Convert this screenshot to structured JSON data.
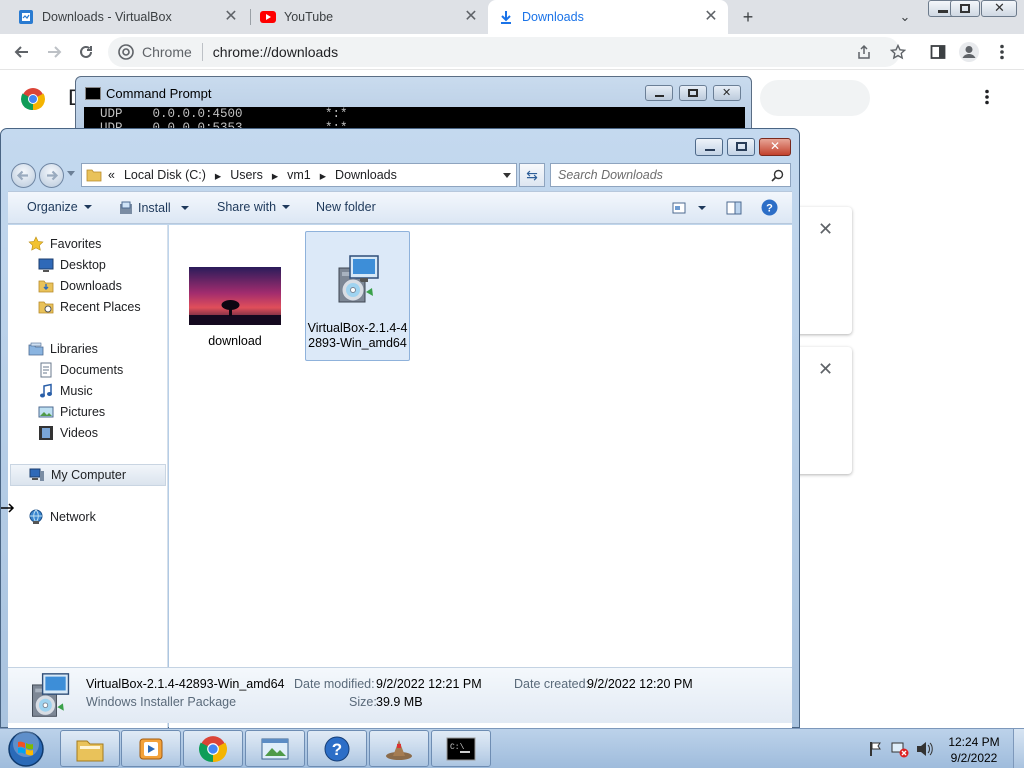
{
  "chrome": {
    "tabs": [
      {
        "title": "Downloads - VirtualBox",
        "icon": "virtualbox-doc-icon",
        "active": false
      },
      {
        "title": "YouTube",
        "icon": "youtube-icon",
        "active": false
      },
      {
        "title": "Downloads",
        "icon": "download-arrow-icon",
        "active": true
      }
    ],
    "site_chip": "Chrome",
    "url": "chrome://downloads"
  },
  "cmd": {
    "title": "Command Prompt",
    "lines": [
      "UDP    0.0.0.0:4500           *:*",
      "UDP    0.0.0.0:5353           *:*"
    ]
  },
  "explorer": {
    "breadcrumb": {
      "chevrons": "«",
      "items": [
        "Local Disk (C:)",
        "Users",
        "vm1",
        "Downloads"
      ]
    },
    "search_placeholder": "Search Downloads",
    "toolbar": {
      "organize": "Organize",
      "install": "Install",
      "share_with": "Share with",
      "new_folder": "New folder"
    },
    "nav": {
      "favorites": "Favorites",
      "desktop": "Desktop",
      "downloads": "Downloads",
      "recent_places": "Recent Places",
      "libraries": "Libraries",
      "documents": "Documents",
      "music": "Music",
      "pictures": "Pictures",
      "videos": "Videos",
      "my_computer": "My Computer",
      "network": "Network"
    },
    "files": [
      {
        "name": "download",
        "type": "image",
        "selected": false
      },
      {
        "name_line1": "VirtualBox-2.1.4-4",
        "name_line2": "2893-Win_amd64",
        "type": "installer",
        "selected": true
      }
    ],
    "details": {
      "name": "VirtualBox-2.1.4-42893-Win_amd64",
      "type": "Windows Installer Package",
      "date_modified_label": "Date modified:",
      "date_modified": "9/2/2022 12:21 PM",
      "date_created_label": "Date created:",
      "date_created": "9/2/2022 12:20 PM",
      "size_label": "Size:",
      "size": "39.9 MB"
    }
  },
  "taskbar": {
    "time": "12:24 PM",
    "date": "9/2/2022"
  }
}
